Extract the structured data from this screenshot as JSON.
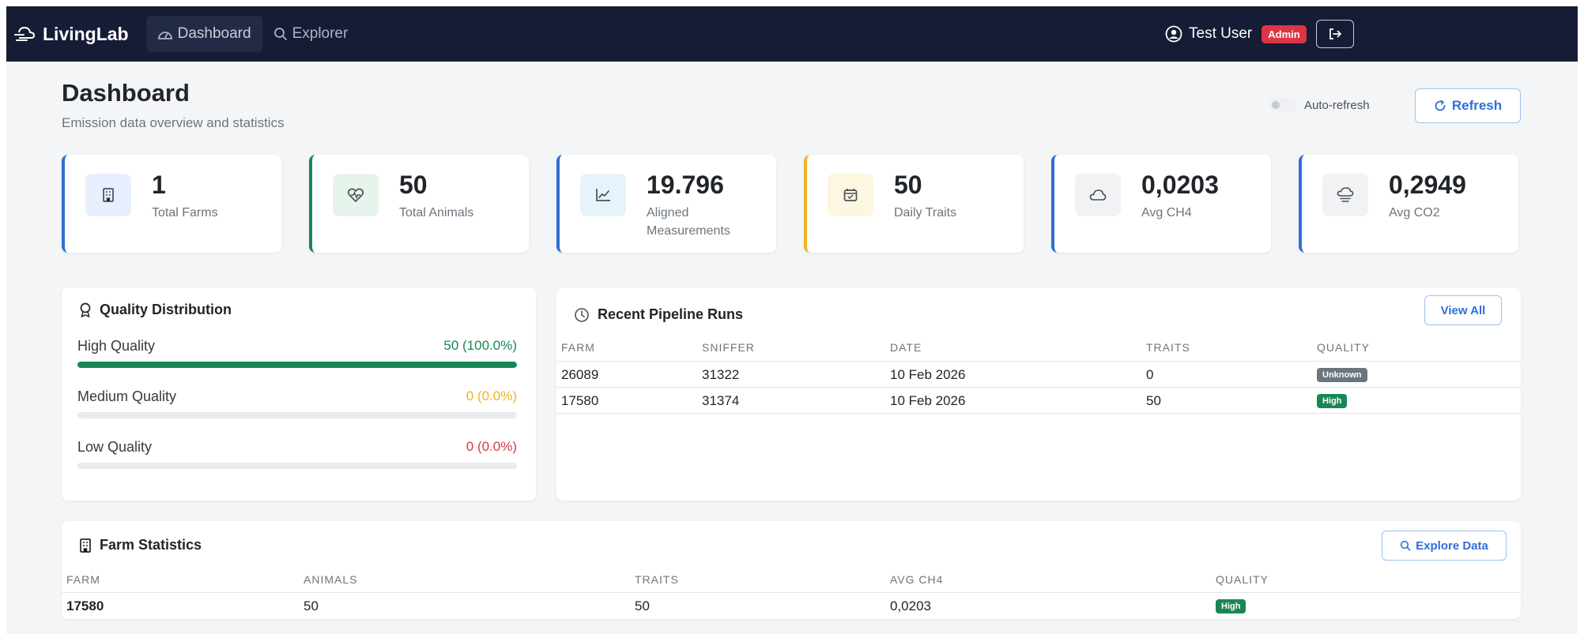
{
  "nav": {
    "brand": "LivingLab",
    "links": [
      {
        "label": "Dashboard",
        "icon": "gauge-icon",
        "active": true
      },
      {
        "label": "Explorer",
        "icon": "search-icon",
        "active": false
      }
    ],
    "user": "Test User",
    "role_badge": "Admin",
    "logout_icon": "logout-icon"
  },
  "header": {
    "title": "Dashboard",
    "subtitle": "Emission data overview and statistics",
    "auto_refresh_label": "Auto-refresh",
    "auto_refresh_on": false,
    "refresh_label": "Refresh"
  },
  "stats": [
    {
      "value": "1",
      "label": "Total Farms",
      "icon": "building-icon",
      "accent": "#2f6fd6",
      "icon_bg": "#e8efff"
    },
    {
      "value": "50",
      "label": "Total Animals",
      "icon": "heart-pulse-icon",
      "accent": "#198754",
      "icon_bg": "#e6f4ec"
    },
    {
      "value": "19.796",
      "label": "Aligned Measurements",
      "icon": "line-chart-icon",
      "accent": "#2f6fd6",
      "icon_bg": "#e6f3fb"
    },
    {
      "value": "50",
      "label": "Daily Traits",
      "icon": "calendar-check-icon",
      "accent": "#f0b323",
      "icon_bg": "#fdf6e1"
    },
    {
      "value": "0,0203",
      "label": "Avg CH4",
      "icon": "cloud-icon",
      "accent": "#2f6fd6",
      "icon_bg": "#f1f2f4"
    },
    {
      "value": "0,2949",
      "label": "Avg CO2",
      "icon": "cloud-haze-icon",
      "accent": "#2f6fd6",
      "icon_bg": "#f1f2f4"
    }
  ],
  "quality": {
    "title": "Quality Distribution",
    "items": [
      {
        "label": "High Quality",
        "value": "50 (100.0%)",
        "fraction": 1.0,
        "color": "#198754"
      },
      {
        "label": "Medium Quality",
        "value": "0 (0.0%)",
        "fraction": 0.0,
        "color": "#f0b323"
      },
      {
        "label": "Low Quality",
        "value": "0 (0.0%)",
        "fraction": 0.0,
        "color": "#dc3545"
      }
    ]
  },
  "pipeline": {
    "title": "Recent Pipeline Runs",
    "view_all_label": "View All",
    "columns": [
      "FARM",
      "SNIFFER",
      "DATE",
      "TRAITS",
      "QUALITY"
    ],
    "rows": [
      {
        "farm": "26089",
        "sniffer": "31322",
        "date": "10 Feb 2026",
        "traits": "0",
        "quality": "Unknown",
        "quality_color": "#6c757d"
      },
      {
        "farm": "17580",
        "sniffer": "31374",
        "date": "10 Feb 2026",
        "traits": "50",
        "quality": "High",
        "quality_color": "#198754"
      }
    ]
  },
  "farm_stats": {
    "title": "Farm Statistics",
    "explore_label": "Explore Data",
    "columns": [
      "FARM",
      "ANIMALS",
      "TRAITS",
      "AVG CH4",
      "QUALITY"
    ],
    "rows": [
      {
        "farm": "17580",
        "animals": "50",
        "traits": "50",
        "avg_ch4": "0,0203",
        "quality": "High",
        "quality_color": "#198754"
      }
    ]
  }
}
